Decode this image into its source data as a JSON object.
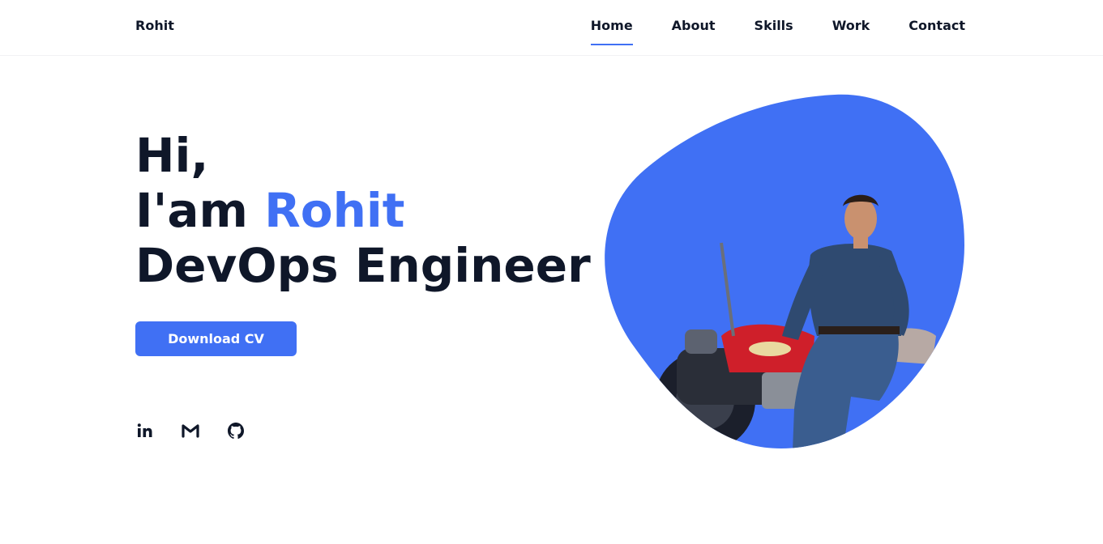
{
  "header": {
    "logo": "Rohit",
    "nav": [
      {
        "label": "Home",
        "active": true
      },
      {
        "label": "About",
        "active": false
      },
      {
        "label": "Skills",
        "active": false
      },
      {
        "label": "Work",
        "active": false
      },
      {
        "label": "Contact",
        "active": false
      }
    ]
  },
  "hero": {
    "greeting": "Hi,",
    "intro_prefix": "I'am ",
    "name": "Rohit",
    "role": "DevOps Engineer",
    "cta_label": "Download CV"
  },
  "social": [
    {
      "icon": "linkedin-icon"
    },
    {
      "icon": "gmail-icon"
    },
    {
      "icon": "github-icon"
    }
  ],
  "colors": {
    "accent": "#4070f4",
    "text": "#0f1729",
    "background": "#ffffff"
  }
}
